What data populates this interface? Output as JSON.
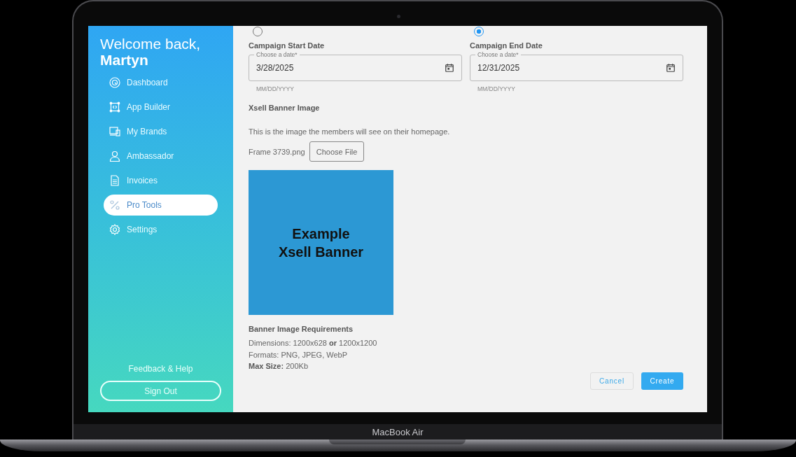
{
  "device": {
    "label": "MacBook Air"
  },
  "sidebar": {
    "greeting": "Welcome back,",
    "user": "Martyn",
    "items": [
      {
        "label": "Dashboard",
        "selected": false
      },
      {
        "label": "App Builder",
        "selected": false
      },
      {
        "label": "My Brands",
        "selected": false
      },
      {
        "label": "Ambassador",
        "selected": false
      },
      {
        "label": "Invoices",
        "selected": false
      },
      {
        "label": "Pro Tools",
        "selected": true
      },
      {
        "label": "Settings",
        "selected": false
      }
    ],
    "feedback": "Feedback & Help",
    "sign_out": "Sign Out"
  },
  "form": {
    "radios": [
      {
        "selected": false
      },
      {
        "selected": true
      }
    ],
    "dates": [
      {
        "title": "Campaign Start Date",
        "label": "Choose a date*",
        "value": "3/28/2025",
        "hint": "MM/DD/YYYY"
      },
      {
        "title": "Campaign End Date",
        "label": "Choose a date*",
        "value": "12/31/2025",
        "hint": "MM/DD/YYYY"
      }
    ],
    "banner": {
      "title": "Xsell Banner Image",
      "description": "This is the image the members will see on their homepage.",
      "file_name": "Frame 3739.png",
      "choose_button": "Choose File",
      "preview_text": "Example Xsell Banner"
    },
    "requirements": {
      "title": "Banner Image Requirements",
      "lines": [
        "Dimensions: 1200x628 **or** 1200x1200",
        "Formats: PNG, JPEG, WebP",
        "**Max Size:** 200Kb"
      ]
    },
    "buttons": {
      "cancel": "Cancel",
      "create": "Create"
    }
  }
}
